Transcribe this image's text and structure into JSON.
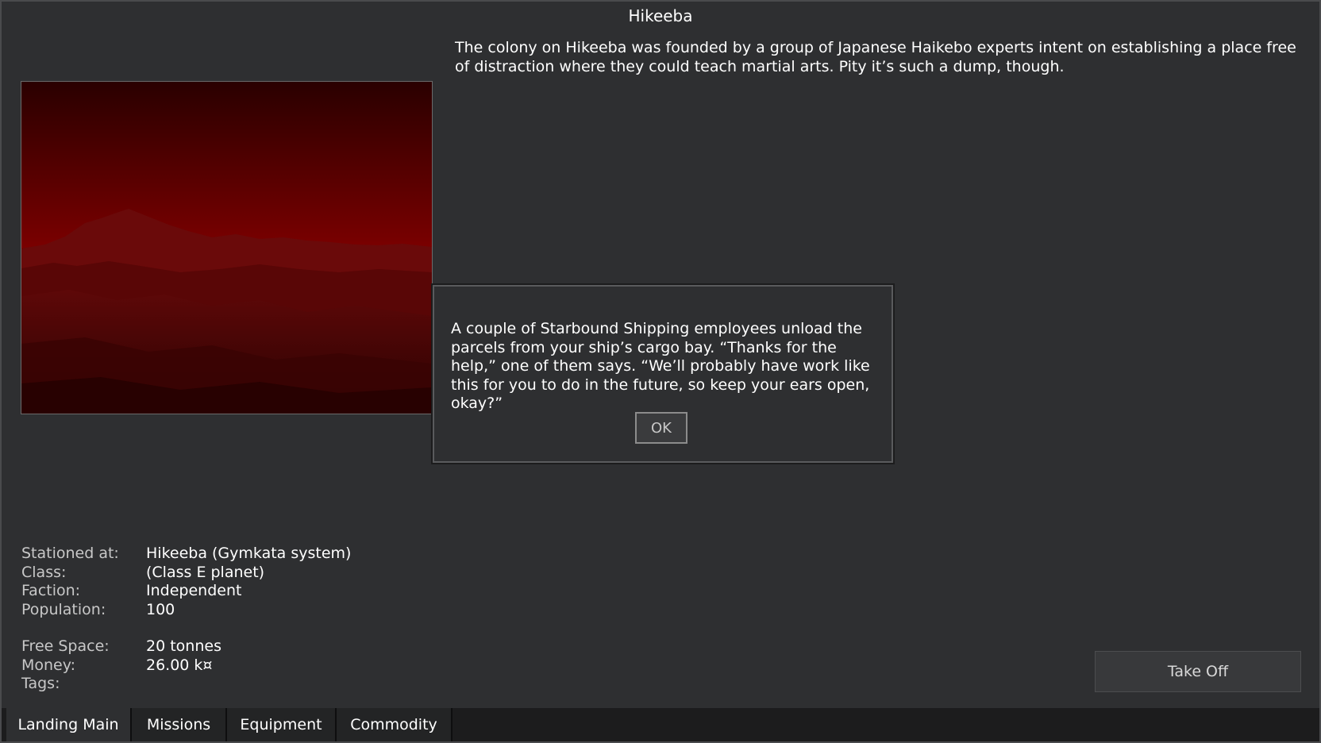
{
  "title": "Hikeeba",
  "planet": {
    "description": "The colony on Hikeeba was founded by a group of Japanese Haikebo experts intent on establishing a place free of distraction where they could teach martial arts. Pity it’s such a dump, though."
  },
  "info": {
    "stationed_label": "Stationed at:",
    "stationed_value": "Hikeeba (Gymkata system)",
    "class_label": "Class:",
    "class_value": "(Class E planet)",
    "faction_label": "Faction:",
    "faction_value": "Independent",
    "population_label": "Population:",
    "population_value": "100",
    "freespace_label": "Free Space:",
    "freespace_value": "20 tonnes",
    "money_label": "Money:",
    "money_value": "26.00 k¤",
    "tags_label": "Tags:",
    "tags_value": ""
  },
  "dialog": {
    "text": "A couple of Starbound Shipping employees unload the parcels from your ship’s cargo bay. “Thanks for the help,” one of them says. “We’ll probably have work like this for you to do in the future, so keep your ears open, okay?”",
    "ok_label": "OK"
  },
  "takeoff_label": "Take Off",
  "tabs": [
    {
      "label": "Landing Main",
      "active": true
    },
    {
      "label": "Missions",
      "active": false
    },
    {
      "label": "Equipment",
      "active": false
    },
    {
      "label": "Commodity",
      "active": false
    }
  ],
  "colors": {
    "background": "#2e2f31",
    "tab_bar": "#1c1c1d",
    "sky_top": "#2a0000",
    "sky_horizon": "#8a0000"
  }
}
